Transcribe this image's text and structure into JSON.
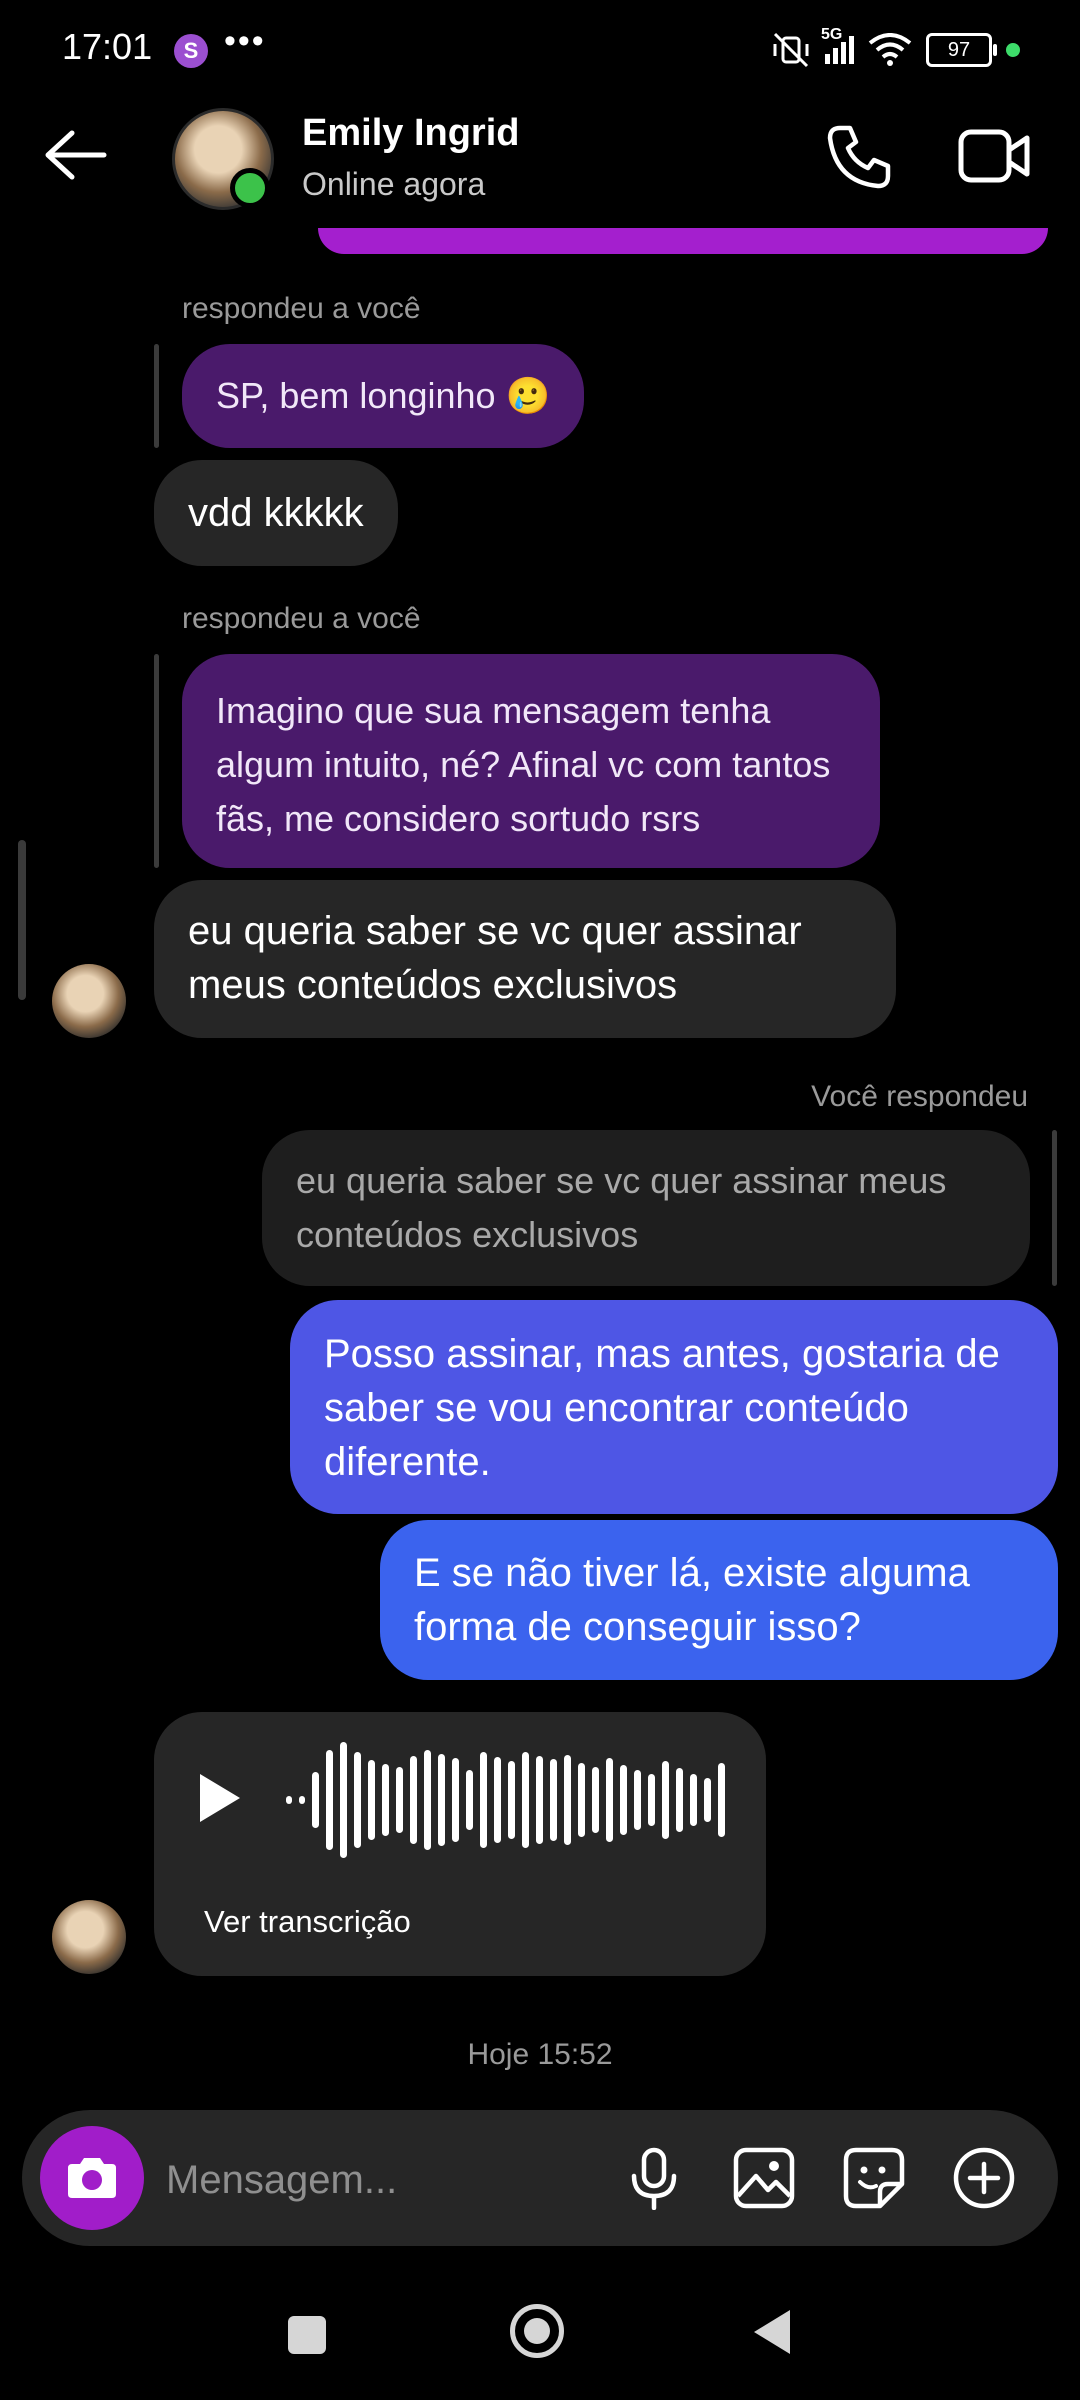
{
  "status_bar": {
    "time": "17:01",
    "app_badge": "S",
    "more": "•••",
    "network": "5G",
    "battery": "97"
  },
  "header": {
    "contact_name": "Emily Ingrid",
    "contact_status": "Online agora"
  },
  "messages": [
    {
      "reply_label": "respondeu a você",
      "quoted": "SP, bem longinho 🥲",
      "text": "vdd kkkkk"
    },
    {
      "reply_label": "respondeu a você",
      "quoted": "Imagino que sua mensagem tenha algum intuito, né? Afinal  vc com tantos fãs, me considero sortudo rsrs",
      "text": "eu queria saber se vc quer assinar meus conteúdos exclusivos"
    },
    {
      "reply_label": "Você respondeu",
      "quoted": "eu queria saber se vc quer assinar meus conteúdos exclusivos",
      "text": "Posso assinar, mas antes, gostaria de saber se vou encontrar conteúdo diferente."
    },
    {
      "text": "E se não tiver lá, existe alguma forma de conseguir isso?"
    }
  ],
  "voice_message": {
    "transcript_link": "Ver transcrição"
  },
  "timestamp": "Hoje 15:52",
  "composer": {
    "placeholder": "Mensagem..."
  },
  "icons": [
    "back-arrow-icon",
    "phone-icon",
    "video-camera-icon",
    "camera-icon",
    "microphone-icon",
    "gallery-icon",
    "sticker-icon",
    "plus-icon",
    "play-icon"
  ],
  "colors": {
    "accent_purple": "#a11dc9",
    "outgoing_blue": "#4e56e5",
    "incoming_bubble": "#262626",
    "online_green": "#3cc24a"
  }
}
